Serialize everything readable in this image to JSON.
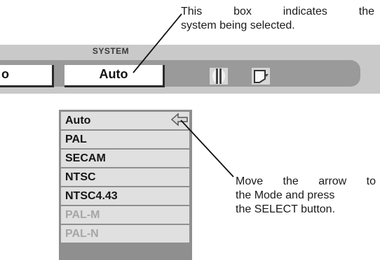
{
  "callouts": {
    "top_line1": "This box indicates the",
    "top_line2": "system being selected.",
    "bottom_line1": "Move the arrow to",
    "bottom_line2": "the Mode and press",
    "bottom_line3": "the SELECT button."
  },
  "menu": {
    "title": "SYSTEM",
    "left_box_text": "o",
    "selected_value": "Auto",
    "icons": [
      "contrast-icon",
      "screen-icon"
    ]
  },
  "dropdown": {
    "items": [
      {
        "label": "Auto",
        "enabled": true,
        "current": true
      },
      {
        "label": "PAL",
        "enabled": true
      },
      {
        "label": "SECAM",
        "enabled": true
      },
      {
        "label": "NTSC",
        "enabled": true
      },
      {
        "label": "NTSC4.43",
        "enabled": true
      },
      {
        "label": "PAL-M",
        "enabled": false
      },
      {
        "label": "PAL-N",
        "enabled": false
      }
    ],
    "pointer_icon": "left-arrow-icon"
  },
  "colors": {
    "panel": "#9a9a9a",
    "menubar": "#c9c9c9",
    "item_bg": "#e0e0e0",
    "disabled_text": "#a6a6a6"
  }
}
